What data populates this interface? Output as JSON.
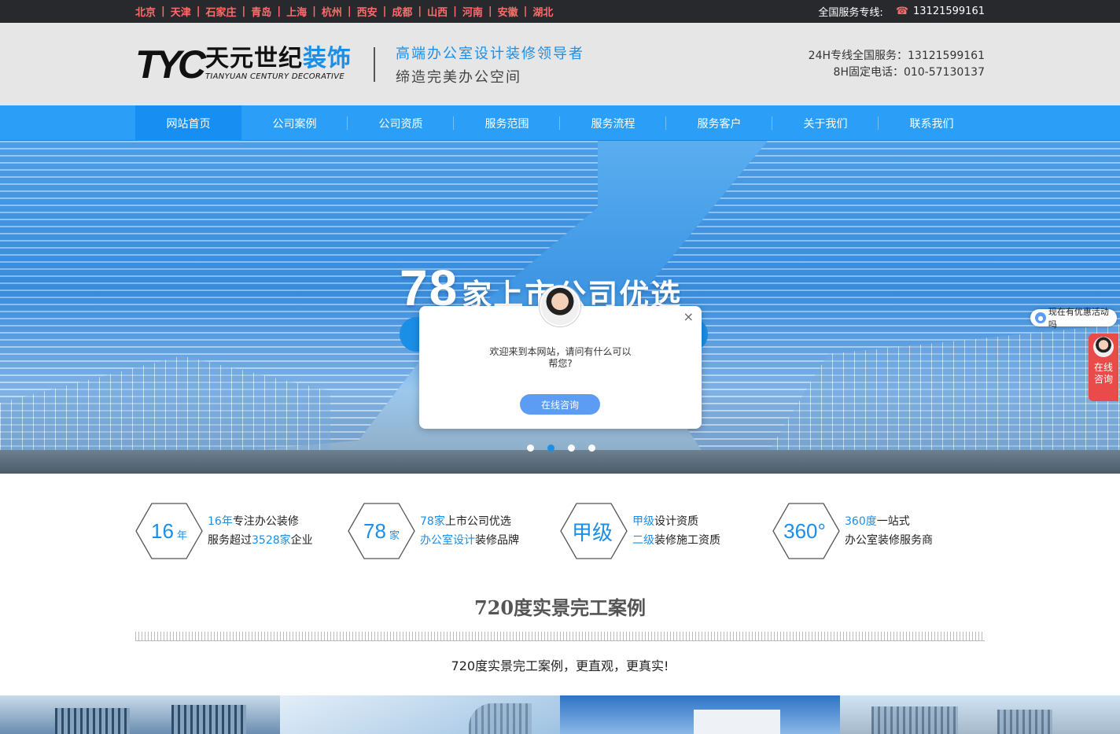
{
  "topbar": {
    "cities": [
      "北京",
      "天津",
      "石家庄",
      "青岛",
      "上海",
      "杭州",
      "西安",
      "成都",
      "山西",
      "河南",
      "安徽",
      "湖北"
    ],
    "hotline_label": "全国服务专线:",
    "hotline_phone": "13121599161",
    "phone_icon": "phone-icon"
  },
  "header": {
    "logo_tyc": "TYC",
    "logo_cn_a": "天元世纪",
    "logo_cn_b": "装饰",
    "logo_en": "TIANYUAN CENTURY DECORATIVE",
    "slogan_1": "高端办公室设计装修领导者",
    "slogan_2": "缔造完美办公空间",
    "contact_1": "24H专线全国服务：13121599161",
    "contact_2": "8H固定电话：010-57130137"
  },
  "nav": {
    "items": [
      "网站首页",
      "公司案例",
      "公司资质",
      "服务范围",
      "服务流程",
      "服务客户",
      "关于我们",
      "联系我们"
    ],
    "active_index": 0
  },
  "banner": {
    "title_num": "78",
    "title_text": "家上市公司优选",
    "slide_count": 4,
    "active_slide": 1
  },
  "popup": {
    "message": "欢迎来到本网站，请问有什么可以帮您?",
    "button": "在线咨询",
    "close": "×"
  },
  "side": {
    "promo": "现在有优惠活动吗",
    "consult": "在线咨询"
  },
  "stats": [
    {
      "hex_value": "16",
      "hex_unit": "年",
      "line1_hl": "16年",
      "line1_rest": "专注办公装修",
      "line2_a": "服务超过",
      "line2_hl": "3528家",
      "line2_b": "企业"
    },
    {
      "hex_value": "78",
      "hex_unit": "家",
      "line1_hl": "78家",
      "line1_rest": "上市公司优选",
      "line2_a": "",
      "line2_hl": "办公室设计",
      "line2_b": "装修品牌"
    },
    {
      "hex_value": "甲级",
      "hex_unit": "",
      "line1_hl": "甲级",
      "line1_rest": "设计资质",
      "line2_a": "",
      "line2_hl": "二级",
      "line2_b": "装修施工资质"
    },
    {
      "hex_value": "360°",
      "hex_unit": "",
      "line1_hl": "360度",
      "line1_rest": "一站式",
      "line2_a": "办公室装修服务商",
      "line2_hl": "",
      "line2_b": ""
    }
  ],
  "section": {
    "title": "720度实景完工案例",
    "subtitle": "720度实景完工案例，更直观，更真实!"
  },
  "colors": {
    "accent": "#1b8ee6",
    "nav": "#2b9ff7",
    "topbar": "#27292c",
    "city": "#ff6b6b"
  }
}
